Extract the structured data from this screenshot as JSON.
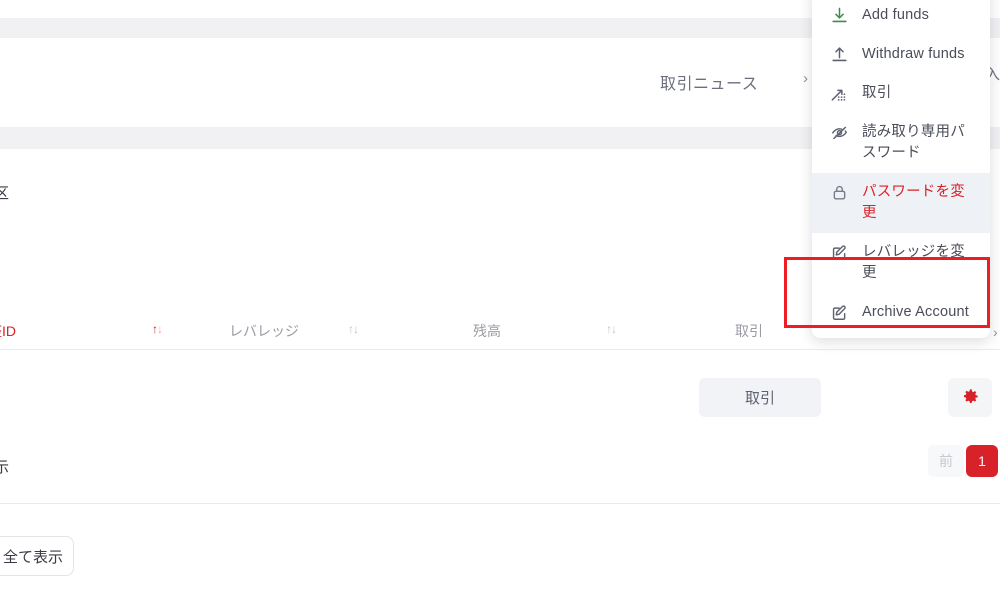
{
  "header": {
    "news_link": "取引ニュース",
    "news_chevron": "›",
    "right_clipped_glyph": "入"
  },
  "clipped_text": {
    "ward_fragment": "区",
    "show_fragment": "示"
  },
  "table": {
    "columns": [
      {
        "label": "座ID",
        "active": true,
        "sortable": true,
        "sort_icon": "sort-asc-desc-icon"
      },
      {
        "label": "レバレッジ",
        "active": false,
        "sortable": true,
        "sort_icon": "sort-asc-desc-icon"
      },
      {
        "label": "残高",
        "active": false,
        "sortable": true,
        "sort_icon": "sort-asc-desc-icon"
      },
      {
        "label": "取引",
        "active": false,
        "sortable": false,
        "sort_icon": ""
      }
    ],
    "sort_up": "↑",
    "sort_down": "↓"
  },
  "actions": {
    "trade_button": "取引",
    "gear_button_icon": "gear-icon",
    "show_all_button": "全て表示"
  },
  "pagination": {
    "prev_label": "前",
    "current_page": "1"
  },
  "menu": {
    "items": [
      {
        "label": "Add funds",
        "icon": "download-arrow-icon",
        "highlighted": false,
        "icon_color": "#3d8b4a"
      },
      {
        "label": "Withdraw funds",
        "icon": "upload-arrow-icon",
        "highlighted": false,
        "icon_color": "#5e6270"
      },
      {
        "label": "取引",
        "icon": "trade-chart-icon",
        "highlighted": false,
        "icon_color": "#5e6270"
      },
      {
        "label": "読み取り専用パスワード",
        "icon": "eye-off-icon",
        "highlighted": false,
        "icon_color": "#5e6270"
      },
      {
        "label": "パスワードを変更",
        "icon": "lock-icon",
        "highlighted": true,
        "icon_color": "#7a7d89"
      },
      {
        "label": "レバレッジを変更",
        "icon": "edit-square-icon",
        "highlighted": false,
        "icon_color": "#5e6270"
      },
      {
        "label": "Archive Account",
        "icon": "edit-square-icon",
        "highlighted": false,
        "icon_color": "#5e6270"
      }
    ],
    "side_chevron": "›"
  },
  "annotation": {
    "target_label": "レバレッジを変更",
    "box_color": "#ee1d23"
  },
  "colors": {
    "brand_red": "#d8222a",
    "annotation_red": "#ee1d23",
    "band_gray": "#f1f1f4",
    "highlight_bg": "#eef1f6",
    "text_gray": "#4a4d59",
    "muted_gray": "#9a9ba4"
  }
}
